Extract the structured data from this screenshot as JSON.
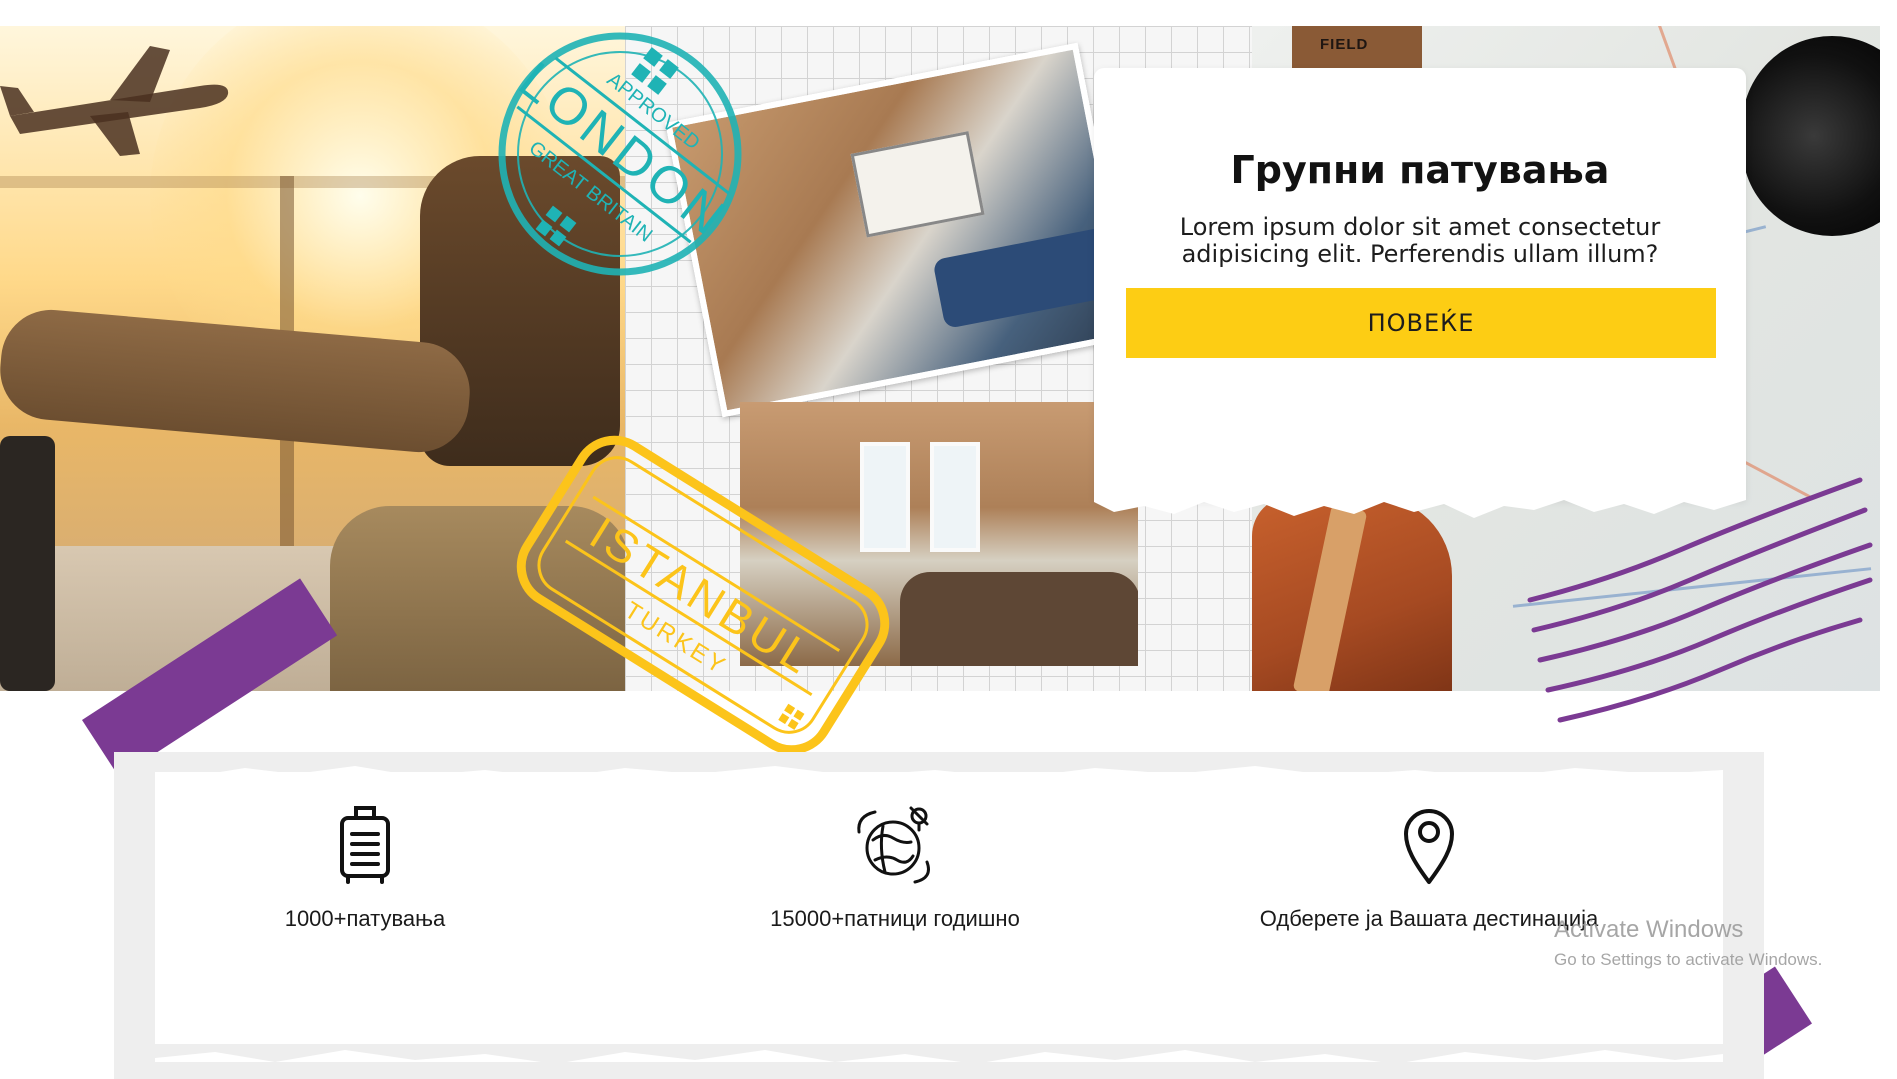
{
  "info_card": {
    "title": "Групни патувања",
    "description": "Lorem ipsum dolor sit amet consectetur adipisicing elit. Perferendis ullam illum?",
    "button_label": "ПОВЕЌЕ"
  },
  "stamps": {
    "london": {
      "top_text": "APPROVED",
      "city": "LONDON",
      "country": "GREAT BRITAIN"
    },
    "istanbul": {
      "city": "ISTANBUL",
      "country": "TURKEY"
    }
  },
  "map_panel": {
    "journal_text": "FIELD"
  },
  "features": [
    {
      "label": "1000+патувања",
      "icon": "luggage-icon"
    },
    {
      "label": "15000+патници годишно",
      "icon": "globe-travel-icon"
    },
    {
      "label": "Одберете ја Вашата дестинација",
      "icon": "location-pin-icon"
    }
  ],
  "watermark": {
    "title": "Activate Windows",
    "subtitle": "Go to Settings to activate Windows."
  },
  "colors": {
    "accent_yellow": "#fdcd14",
    "tape_purple": "#7b3a93",
    "stamp_teal": "#1fb3b5",
    "stamp_yellow": "#fcc41a"
  }
}
